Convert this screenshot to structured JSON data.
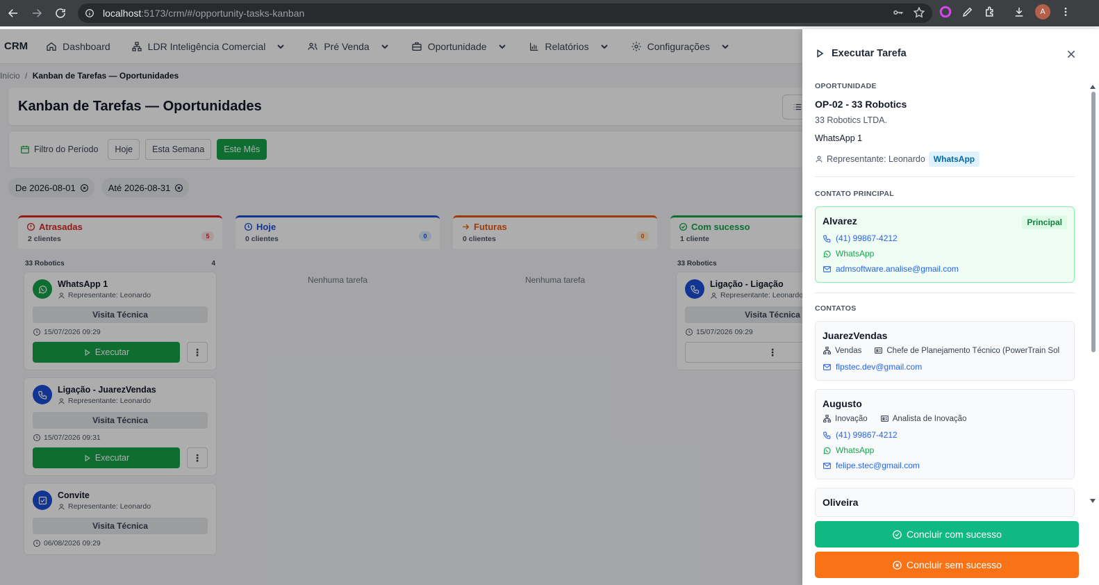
{
  "browser": {
    "url_host": "localhost",
    "url_path": ":5173/crm/#/opportunity-tasks-kanban",
    "avatar_letter": "A"
  },
  "nav": {
    "brand": "CRM",
    "items": [
      {
        "label": "Dashboard",
        "icon": "home-icon"
      },
      {
        "label": "LDR Inteligência Comercial",
        "icon": "sitemap-icon"
      },
      {
        "label": "Pré Venda",
        "icon": "users-icon"
      },
      {
        "label": "Oportunidade",
        "icon": "briefcase-icon"
      },
      {
        "label": "Relatórios",
        "icon": "bar-chart-icon"
      },
      {
        "label": "Configurações",
        "icon": "gear-icon"
      }
    ]
  },
  "breadcrumb": {
    "home": "Início",
    "sep": "/",
    "current": "Kanban de Tarefas — Oportunidades"
  },
  "page": {
    "title": "Kanban de Tarefas — Oportunidades"
  },
  "filter": {
    "label": "Filtro do Período",
    "buttons": [
      "Hoje",
      "Esta Semana",
      "Este Mês"
    ],
    "active": "Este Mês",
    "from": "De 2026-08-01",
    "to": "Até 2026-08-31"
  },
  "columns": [
    {
      "title": "Atrasadas",
      "subtitle": "2 clientes",
      "count": "5",
      "color": "#dc2626",
      "empty": ""
    },
    {
      "title": "Hoje",
      "subtitle": "0 clientes",
      "count": "0",
      "color": "#1d4ed8",
      "empty": "Nenhuma tarefa"
    },
    {
      "title": "Futuras",
      "subtitle": "0 clientes",
      "count": "0",
      "color": "#ea580c",
      "empty": "Nenhuma tarefa"
    },
    {
      "title": "Com sucesso",
      "subtitle": "1 cliente",
      "count": "",
      "color": "#16a34a",
      "empty": ""
    }
  ],
  "overdue": {
    "group_name": "33 Robotics",
    "group_count": "4",
    "cards": [
      {
        "title": "WhatsApp 1",
        "rep": "Representante: Leonardo",
        "type": "Visita Técnica",
        "date": "15/07/2026 09:29",
        "action": "Executar"
      },
      {
        "title": "Ligação - JuarezVendas",
        "rep": "Representante: Leonardo",
        "type": "Visita Técnica",
        "date": "15/07/2026 09:31",
        "action": "Executar"
      },
      {
        "title": "Convite",
        "rep": "Representante: Leonardo",
        "type": "Visita Técnica",
        "date": "06/08/2026 09:29"
      }
    ]
  },
  "success": {
    "group_name": "33 Robotics",
    "card": {
      "title": "Ligação - Ligação",
      "rep": "Representante: Leonardo",
      "type": "Visita Técnica",
      "date": "15/07/2026 09:29"
    }
  },
  "drawer": {
    "title": "Executar Tarefa",
    "opp_label": "OPORTUNIDADE",
    "opp_code": "OP-02 - 33 Robotics",
    "company": "33 Robotics LTDA.",
    "task": "WhatsApp 1",
    "rep": "Representante: Leonardo",
    "channel_badge": "WhatsApp",
    "main_contact_label": "CONTATO PRINCIPAL",
    "main_contact": {
      "name": "Alvarez",
      "badge": "Principal",
      "phone": "(41) 99867-4212",
      "whatsapp": "WhatsApp",
      "email": "admsoftware.analise@gmail.com"
    },
    "contacts_label": "CONTATOS",
    "contacts": [
      {
        "name": "JuarezVendas",
        "department": "Vendas",
        "role": "Chefe de Planejamento Técnico (PowerTrain Sol",
        "email": "flpstec.dev@gmail.com"
      },
      {
        "name": "Augusto",
        "department": "Inovação",
        "role": "Analista de Inovação",
        "phone": "(41) 99867-4212",
        "whatsapp": "WhatsApp",
        "email": "felipe.stec@gmail.com"
      },
      {
        "name": "Oliveira"
      }
    ],
    "btn_success": "Concluir com sucesso",
    "btn_fail": "Concluir sem sucesso"
  }
}
